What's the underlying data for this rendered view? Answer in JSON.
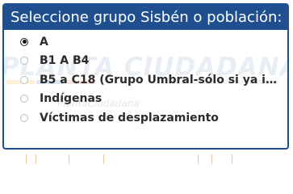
{
  "header": {
    "title": "Seleccione grupo Sisbén o población:"
  },
  "watermark": {
    "text": "PLANTA CIUDADANA",
    "subtext": "PlantaCiudadana"
  },
  "options": [
    {
      "label": "A",
      "checked": true
    },
    {
      "label": "B1 A B4",
      "checked": false
    },
    {
      "label": "B5 a C18 (Grupo Umbral-sólo si ya in...",
      "checked": false
    },
    {
      "label": "Indígenas",
      "checked": false
    },
    {
      "label": "Víctimas de desplazamiento",
      "checked": false
    }
  ],
  "colors": {
    "header_bg": "#1f4f8e",
    "border": "#1e4f8f",
    "text": "#2b2b2b"
  }
}
